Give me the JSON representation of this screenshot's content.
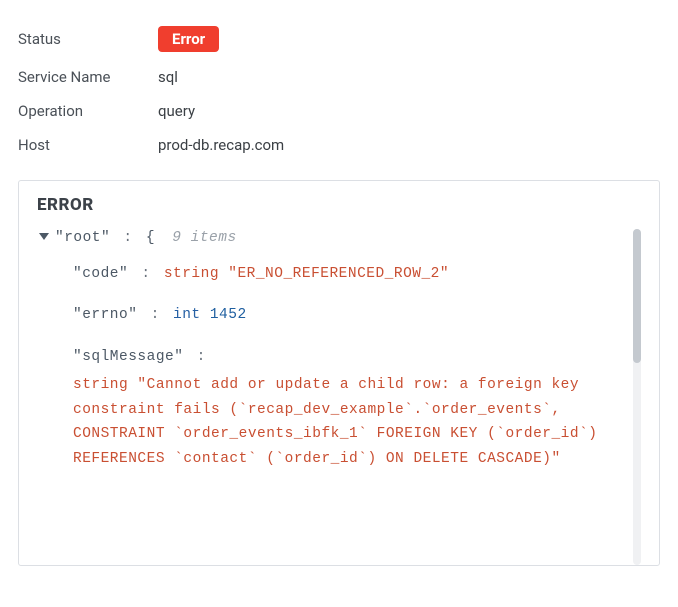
{
  "details": {
    "status_label": "Status",
    "status_badge": "Error",
    "service_label": "Service Name",
    "service_value": "sql",
    "operation_label": "Operation",
    "operation_value": "query",
    "host_label": "Host",
    "host_value": "prod-db.recap.com"
  },
  "panel": {
    "title": "ERROR"
  },
  "json_view": {
    "root_key": "\"root\"",
    "root_brace": "{",
    "item_count_text": "9 items",
    "code_key": "\"code\"",
    "code_type": "string",
    "code_value": "\"ER_NO_REFERENCED_ROW_2\"",
    "errno_key": "\"errno\"",
    "errno_type": "int",
    "errno_value": "1452",
    "sqlmsg_key": "\"sqlMessage\"",
    "sqlmsg_type": "string",
    "sqlmsg_value": "\"Cannot add or update a child row: a foreign key constraint fails (`recap_dev_example`.`order_events`, CONSTRAINT `order_events_ibfk_1` FOREIGN KEY (`order_id`) REFERENCES `contact` (`order_id`) ON DELETE CASCADE)\""
  },
  "colors": {
    "error_badge": "#f03e2e",
    "string_token": "#c94f32",
    "number_token": "#1f5fa0"
  }
}
